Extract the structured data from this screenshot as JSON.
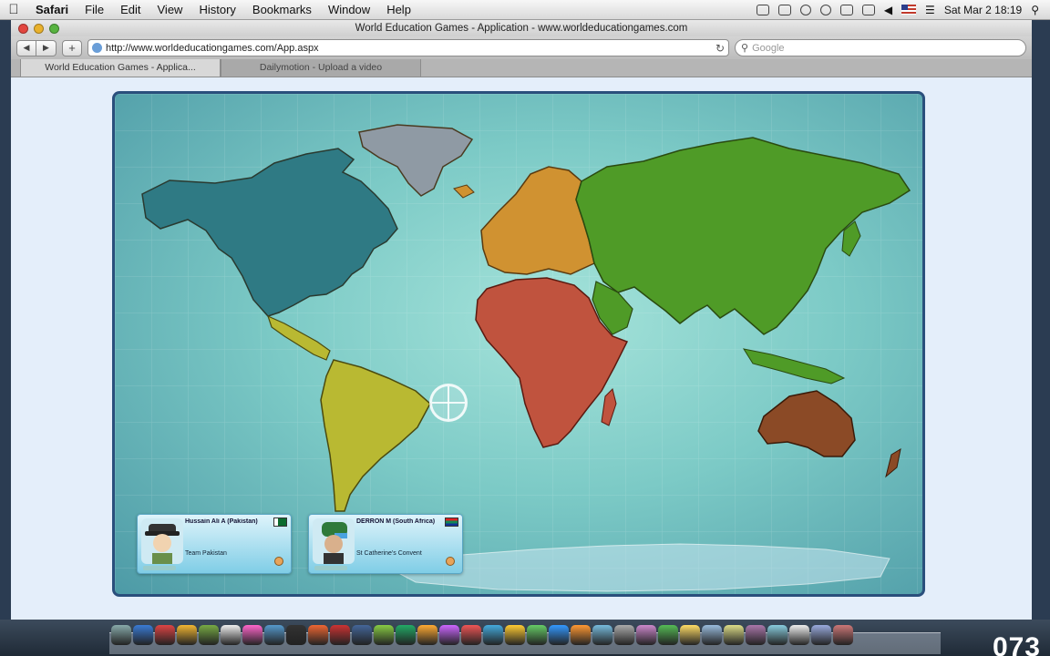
{
  "menubar": {
    "app_name": "Safari",
    "items": [
      "File",
      "Edit",
      "View",
      "History",
      "Bookmarks",
      "Window",
      "Help"
    ],
    "clock": "Sat Mar 2  18:19"
  },
  "window": {
    "title": "World Education Games - Application - www.worldeducationgames.com",
    "url": "http://www.worldeducationgames.com/App.aspx",
    "search_placeholder": "Google",
    "tabs": [
      {
        "label": "World Education Games - Applica..."
      },
      {
        "label": "Dailymotion - Upload a video"
      }
    ]
  },
  "game": {
    "continents": [
      "north-america",
      "south-america",
      "greenland",
      "europe",
      "africa",
      "asia",
      "australia",
      "antarctica"
    ],
    "colors": {
      "north_america": "#2f7a84",
      "south_america": "#b9b932",
      "greenland": "#8f9aa4",
      "europe": "#d09231",
      "africa": "#c0533e",
      "asia": "#4f9b27",
      "australia": "#8b4a26",
      "ocean": "#7ccac6"
    },
    "players": [
      {
        "name": "Hussain Ali A (Pakistan)",
        "school": "Team Pakistan"
      },
      {
        "name": "DERRON M (South Africa)",
        "school": "St Catherine's Convent"
      }
    ]
  },
  "dock": {
    "corner_text": "073"
  }
}
